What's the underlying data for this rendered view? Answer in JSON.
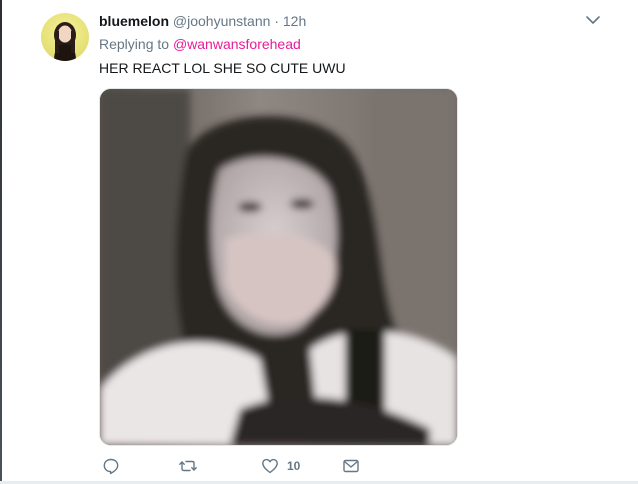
{
  "tweet": {
    "display_name": "bluemelon",
    "handle": "@joohyunstann",
    "separator": "·",
    "time": "12h",
    "replying_prefix": "Replying to",
    "replying_to": "@wanwansforehead",
    "text": "HER REACT LOL SHE SO CUTE UWU",
    "media_icon": "photo-of-woman-covering-mouth"
  },
  "actions": {
    "reply_icon": "reply-icon",
    "retweet_icon": "retweet-icon",
    "like_icon": "heart-icon",
    "like_count": "10",
    "dm_icon": "envelope-icon"
  },
  "colors": {
    "accent": "#e81c9b",
    "text": "#14171a",
    "secondary": "#657786",
    "avatar_bg": "#e8e37a"
  }
}
